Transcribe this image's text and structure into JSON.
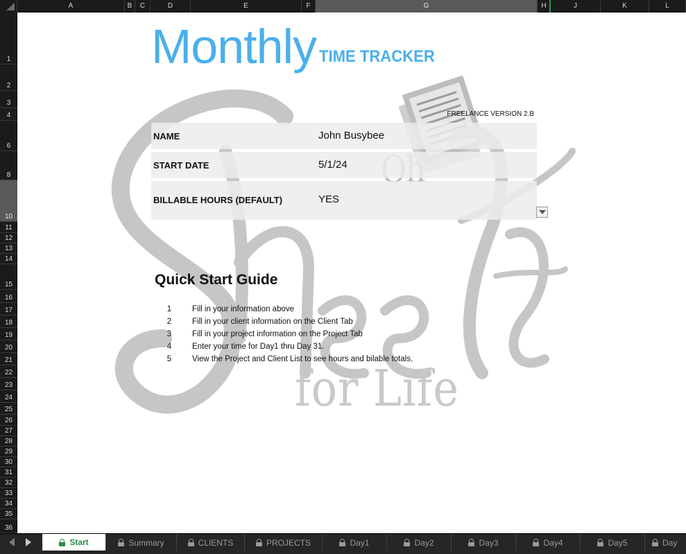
{
  "columns": [
    {
      "label": "A"
    },
    {
      "label": "B"
    },
    {
      "label": "C"
    },
    {
      "label": "D"
    },
    {
      "label": "E"
    },
    {
      "label": "F"
    },
    {
      "label": "G"
    },
    {
      "label": "H"
    },
    {
      "label": "J"
    },
    {
      "label": "K"
    },
    {
      "label": "L"
    }
  ],
  "rows": [
    "1",
    "2",
    "3",
    "4",
    "6",
    "8",
    "10",
    "11",
    "12",
    "13",
    "14",
    "15",
    "16",
    "17",
    "18",
    "19",
    "20",
    "21",
    "22",
    "23",
    "24",
    "25",
    "26",
    "27",
    "28",
    "29",
    "30",
    "31",
    "32",
    "33",
    "34",
    "35",
    "36"
  ],
  "title": {
    "main": "Monthly",
    "sub": "TIME TRACKER"
  },
  "version": "FREELANCE VERSION  2.B",
  "info": [
    {
      "label": "NAME",
      "value": "John  Busybee"
    },
    {
      "label": "START DATE",
      "value": "5/1/24"
    },
    {
      "label": "BILLABLE HOURS (DEFAULT)",
      "value": "YES"
    }
  ],
  "guide": {
    "title": "Quick Start Guide",
    "steps": [
      {
        "num": "1",
        "text": "Fill in your information above"
      },
      {
        "num": "2",
        "text": "Fill in your client information on the Client Tab"
      },
      {
        "num": "3",
        "text": "Fill in your project information on the Project Tab"
      },
      {
        "num": "4",
        "text": "Enter your time for Day1 thru Day 31."
      },
      {
        "num": "5",
        "text": "View the Project and Client List to see hours and bilable totals."
      }
    ]
  },
  "watermark": {
    "oh": "Oh",
    "sheets": "Sheets",
    "for_life": "for Life"
  },
  "tabs": [
    {
      "label": "Start",
      "active": true
    },
    {
      "label": "Summary"
    },
    {
      "label": "CLIENTS"
    },
    {
      "label": "PROJECTS"
    },
    {
      "label": "Day1"
    },
    {
      "label": "Day2"
    },
    {
      "label": "Day3"
    },
    {
      "label": "Day4"
    },
    {
      "label": "Day5"
    },
    {
      "label": "Day"
    }
  ],
  "colors": {
    "title_blue": "#4ab0ea",
    "active_tab_text": "#2a8a4a",
    "header_bg": "#1b1b1b"
  }
}
